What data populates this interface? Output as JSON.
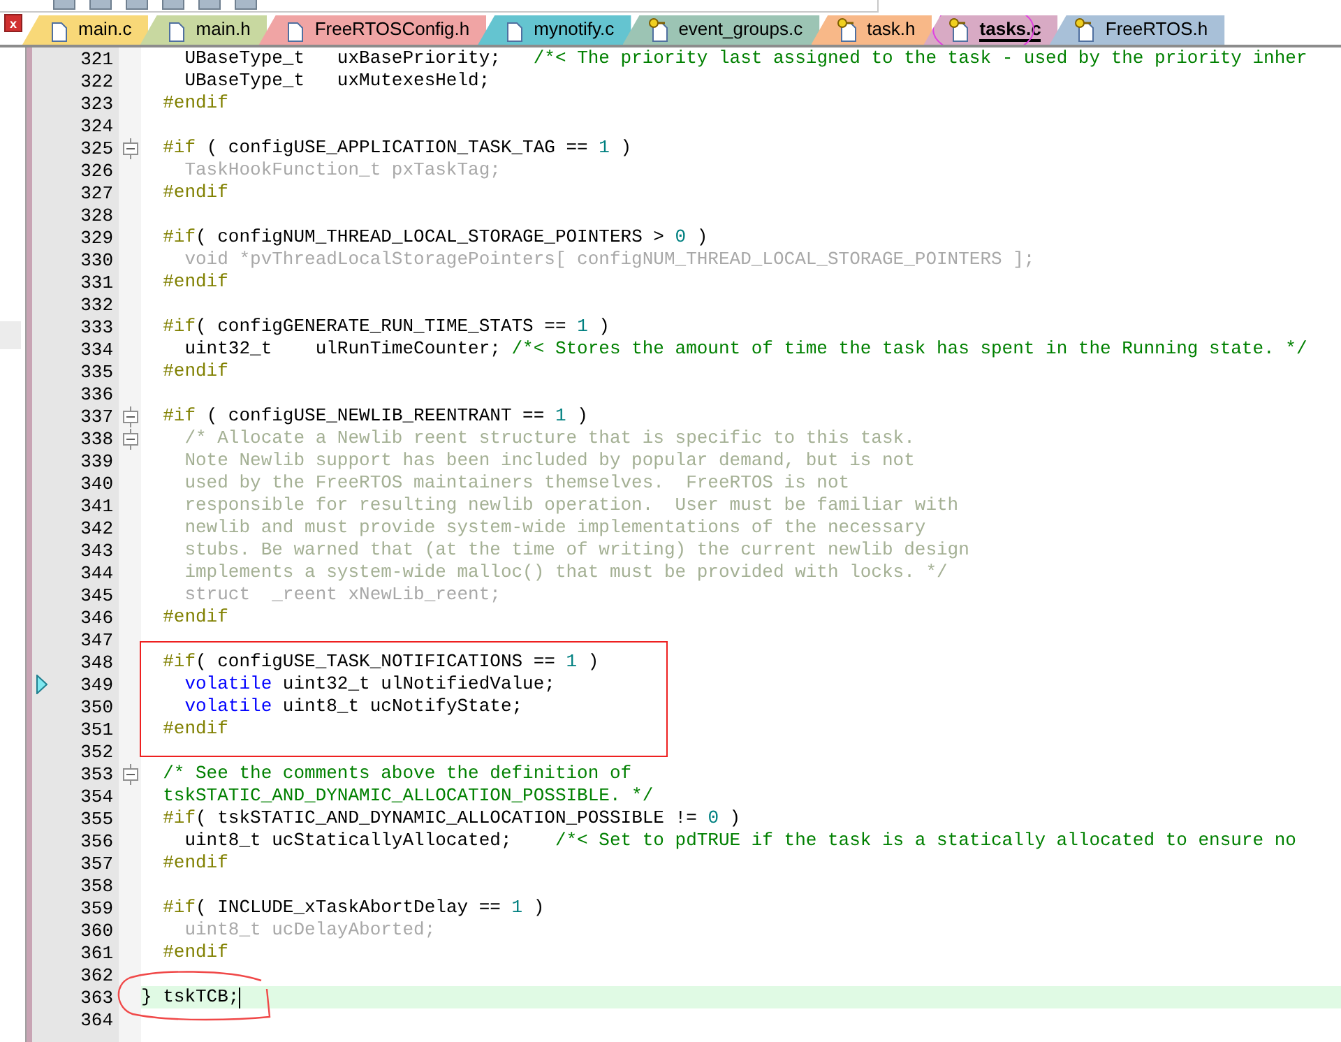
{
  "tabs": [
    {
      "label": "main.c",
      "color": "#f8d878",
      "read_only": false,
      "selected": false,
      "circled": false
    },
    {
      "label": "main.h",
      "color": "#c8d8a0",
      "read_only": false,
      "selected": false,
      "circled": false
    },
    {
      "label": "FreeRTOSConfig.h",
      "color": "#f0a4a4",
      "read_only": false,
      "selected": false,
      "circled": false
    },
    {
      "label": "mynotify.c",
      "color": "#64c4d0",
      "read_only": false,
      "selected": false,
      "circled": false
    },
    {
      "label": "event_groups.c",
      "color": "#9cc4b4",
      "read_only": true,
      "selected": false,
      "circled": false
    },
    {
      "label": "task.h",
      "color": "#f8b888",
      "read_only": true,
      "selected": false,
      "circled": false
    },
    {
      "label": "tasks.c",
      "color": "#d8aac4",
      "read_only": true,
      "selected": true,
      "circled": true
    },
    {
      "label": "FreeRTOS.h",
      "color": "#a8c0d8",
      "read_only": true,
      "selected": false,
      "circled": false
    }
  ],
  "close_button": {
    "label": "x"
  },
  "lines": [
    {
      "number": "321",
      "segments": [
        {
          "kind": "plain",
          "text": "    UBaseType_t   uxBasePriority;   "
        },
        {
          "kind": "comment",
          "text": "/*< The priority last assigned to the task - used by the priority inher"
        }
      ]
    },
    {
      "number": "322",
      "segments": [
        {
          "kind": "plain",
          "text": "    UBaseType_t   uxMutexesHeld;"
        }
      ]
    },
    {
      "number": "323",
      "segments": [
        {
          "kind": "pp",
          "text": "  #endif"
        }
      ]
    },
    {
      "number": "324"
    },
    {
      "number": "325",
      "fold": true,
      "segments": [
        {
          "kind": "pp",
          "text": "  #if"
        },
        {
          "kind": "plain",
          "text": " ( configUSE_APPLICATION_TASK_TAG == "
        },
        {
          "kind": "num",
          "text": "1"
        },
        {
          "kind": "plain",
          "text": " )"
        }
      ]
    },
    {
      "number": "326",
      "segments": [
        {
          "kind": "inactive",
          "text": "    TaskHookFunction_t pxTaskTag;"
        }
      ]
    },
    {
      "number": "327",
      "segments": [
        {
          "kind": "pp",
          "text": "  #endif"
        }
      ]
    },
    {
      "number": "328"
    },
    {
      "number": "329",
      "segments": [
        {
          "kind": "pp",
          "text": "  #if"
        },
        {
          "kind": "plain",
          "text": "( configNUM_THREAD_LOCAL_STORAGE_POINTERS > "
        },
        {
          "kind": "num",
          "text": "0"
        },
        {
          "kind": "plain",
          "text": " )"
        }
      ]
    },
    {
      "number": "330",
      "segments": [
        {
          "kind": "inactive",
          "text": "    void *pvThreadLocalStoragePointers[ configNUM_THREAD_LOCAL_STORAGE_POINTERS ];"
        }
      ]
    },
    {
      "number": "331",
      "segments": [
        {
          "kind": "pp",
          "text": "  #endif"
        }
      ]
    },
    {
      "number": "332"
    },
    {
      "number": "333",
      "segments": [
        {
          "kind": "pp",
          "text": "  #if"
        },
        {
          "kind": "plain",
          "text": "( configGENERATE_RUN_TIME_STATS == "
        },
        {
          "kind": "num",
          "text": "1"
        },
        {
          "kind": "plain",
          "text": " )"
        }
      ]
    },
    {
      "number": "334",
      "segments": [
        {
          "kind": "plain",
          "text": "    uint32_t    ulRunTimeCounter; "
        },
        {
          "kind": "comment",
          "text": "/*< Stores the amount of time the task has spent in the Running state. */"
        }
      ]
    },
    {
      "number": "335",
      "segments": [
        {
          "kind": "pp",
          "text": "  #endif"
        }
      ]
    },
    {
      "number": "336"
    },
    {
      "number": "337",
      "fold": true,
      "segments": [
        {
          "kind": "pp",
          "text": "  #if"
        },
        {
          "kind": "plain",
          "text": " ( configUSE_NEWLIB_REENTRANT == "
        },
        {
          "kind": "num",
          "text": "1"
        },
        {
          "kind": "plain",
          "text": " )"
        }
      ]
    },
    {
      "number": "338",
      "fold": true,
      "segments": [
        {
          "kind": "inactive_comment",
          "text": "    /* Allocate a Newlib reent structure that is specific to this task."
        }
      ]
    },
    {
      "number": "339",
      "segments": [
        {
          "kind": "inactive_comment",
          "text": "    Note Newlib support has been included by popular demand, but is not"
        }
      ]
    },
    {
      "number": "340",
      "segments": [
        {
          "kind": "inactive_comment",
          "text": "    used by the FreeRTOS maintainers themselves.  FreeRTOS is not"
        }
      ]
    },
    {
      "number": "341",
      "segments": [
        {
          "kind": "inactive_comment",
          "text": "    responsible for resulting newlib operation.  User must be familiar with"
        }
      ]
    },
    {
      "number": "342",
      "segments": [
        {
          "kind": "inactive_comment",
          "text": "    newlib and must provide system-wide implementations of the necessary"
        }
      ]
    },
    {
      "number": "343",
      "segments": [
        {
          "kind": "inactive_comment",
          "text": "    stubs. Be warned that (at the time of writing) the current newlib design"
        }
      ]
    },
    {
      "number": "344",
      "segments": [
        {
          "kind": "inactive_comment",
          "text": "    implements a system-wide malloc() that must be provided with locks. */"
        }
      ]
    },
    {
      "number": "345",
      "segments": [
        {
          "kind": "inactive",
          "text": "    struct  _reent xNewLib_reent;"
        }
      ]
    },
    {
      "number": "346",
      "segments": [
        {
          "kind": "pp",
          "text": "  #endif"
        }
      ]
    },
    {
      "number": "347"
    },
    {
      "number": "348",
      "boxed": true,
      "segments": [
        {
          "kind": "pp",
          "text": "  #if"
        },
        {
          "kind": "plain",
          "text": "( configUSE_TASK_NOTIFICATIONS == "
        },
        {
          "kind": "num",
          "text": "1"
        },
        {
          "kind": "plain",
          "text": " )"
        }
      ]
    },
    {
      "number": "349",
      "bookmark": true,
      "boxed": true,
      "segments": [
        {
          "kind": "keyword",
          "text": "    volatile"
        },
        {
          "kind": "plain",
          "text": " uint32_t ulNotifiedValue;"
        }
      ]
    },
    {
      "number": "350",
      "boxed": true,
      "segments": [
        {
          "kind": "keyword",
          "text": "    volatile"
        },
        {
          "kind": "plain",
          "text": " uint8_t ucNotifyState;"
        }
      ]
    },
    {
      "number": "351",
      "boxed": true,
      "segments": [
        {
          "kind": "pp",
          "text": "  #endif"
        }
      ]
    },
    {
      "number": "352"
    },
    {
      "number": "353",
      "fold": true,
      "segments": [
        {
          "kind": "comment",
          "text": "  /* See the comments above the definition of"
        }
      ]
    },
    {
      "number": "354",
      "segments": [
        {
          "kind": "comment",
          "text": "  tskSTATIC_AND_DYNAMIC_ALLOCATION_POSSIBLE. */"
        }
      ]
    },
    {
      "number": "355",
      "segments": [
        {
          "kind": "pp",
          "text": "  #if"
        },
        {
          "kind": "plain",
          "text": "( tskSTATIC_AND_DYNAMIC_ALLOCATION_POSSIBLE != "
        },
        {
          "kind": "num",
          "text": "0"
        },
        {
          "kind": "plain",
          "text": " )"
        }
      ]
    },
    {
      "number": "356",
      "segments": [
        {
          "kind": "plain",
          "text": "    uint8_t ucStaticallyAllocated;    "
        },
        {
          "kind": "comment",
          "text": "/*< Set to pdTRUE if the task is a statically allocated to ensure no"
        }
      ]
    },
    {
      "number": "357",
      "segments": [
        {
          "kind": "pp",
          "text": "  #endif"
        }
      ]
    },
    {
      "number": "358"
    },
    {
      "number": "359",
      "segments": [
        {
          "kind": "pp",
          "text": "  #if"
        },
        {
          "kind": "plain",
          "text": "( INCLUDE_xTaskAbortDelay == "
        },
        {
          "kind": "num",
          "text": "1"
        },
        {
          "kind": "plain",
          "text": " )"
        }
      ]
    },
    {
      "number": "360",
      "segments": [
        {
          "kind": "inactive",
          "text": "    uint8_t ucDelayAborted;"
        }
      ]
    },
    {
      "number": "361",
      "segments": [
        {
          "kind": "pp",
          "text": "  #endif"
        }
      ]
    },
    {
      "number": "362"
    },
    {
      "number": "363",
      "current": true,
      "circled": true,
      "segments": [
        {
          "kind": "plain",
          "text": "} tskTCB;"
        }
      ]
    },
    {
      "number": "364"
    }
  ]
}
